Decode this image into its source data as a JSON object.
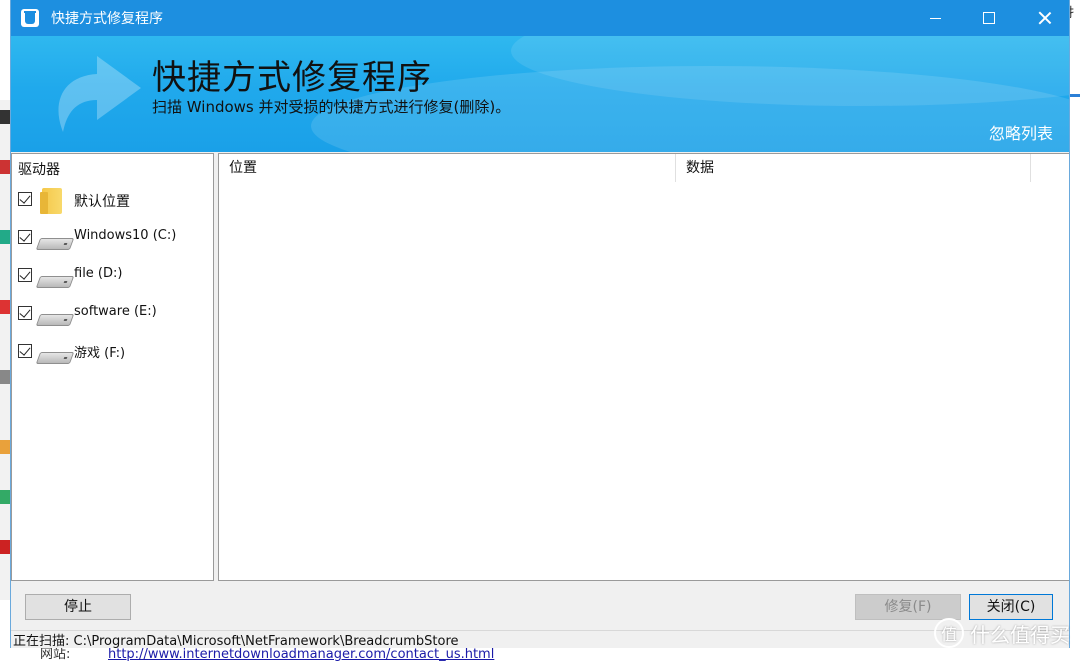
{
  "window": {
    "title": "快捷方式修复程序"
  },
  "banner": {
    "title": "快捷方式修复程序",
    "subtitle": "扫描 Windows 并对受损的快捷方式进行修复(删除)。",
    "ignore_link": "忽略列表"
  },
  "left_panel": {
    "header": "驱动器",
    "items": [
      {
        "label": "默认位置",
        "checked": true,
        "icon": "folder-icon"
      },
      {
        "label": "Windows10 (C:)",
        "checked": true,
        "icon": "drive-icon"
      },
      {
        "label": "file (D:)",
        "checked": true,
        "icon": "drive-icon"
      },
      {
        "label": "software (E:)",
        "checked": true,
        "icon": "drive-icon"
      },
      {
        "label": "游戏 (F:)",
        "checked": true,
        "icon": "drive-icon"
      }
    ]
  },
  "results": {
    "columns": [
      "位置",
      "数据"
    ]
  },
  "buttons": {
    "stop": "停止",
    "repair": "修复(F)",
    "close": "关闭(C)"
  },
  "status": {
    "text": "正在扫描: C:\\ProgramData\\Microsoft\\NetFramework\\BreadcrumbStore"
  },
  "background": {
    "right_char": "扌",
    "bottom_label": "网站:",
    "bottom_url": "http://www.internetdownloadmanager.com/contact_us.html"
  },
  "watermark": {
    "text": "什么值得买",
    "icon_glyph": "值"
  },
  "colors": {
    "titlebar": "#1d8fe0",
    "banner": "#20a9ec"
  }
}
